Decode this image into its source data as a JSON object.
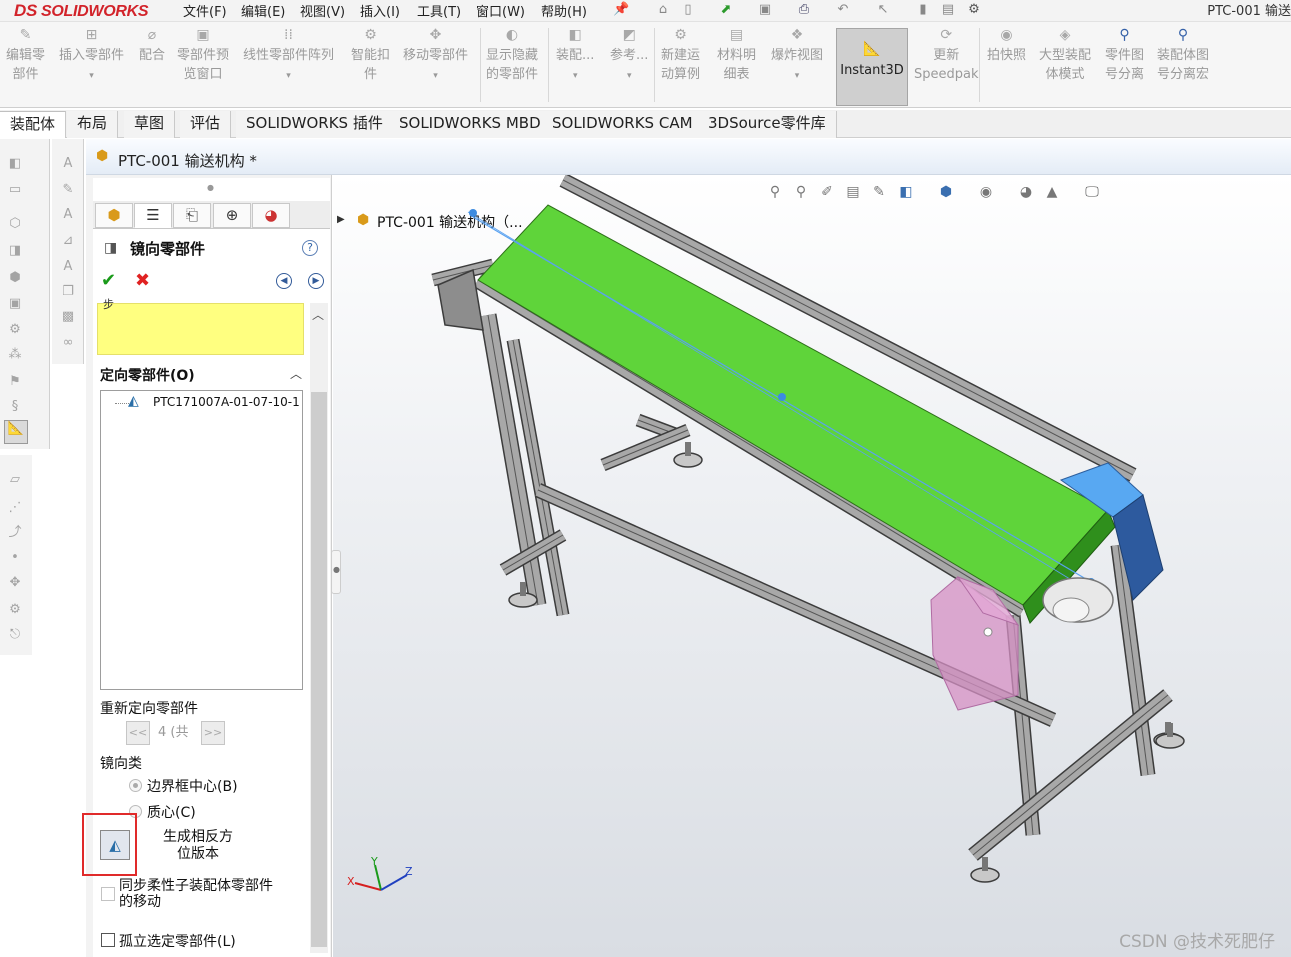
{
  "app": {
    "brand": "SOLIDWORKS",
    "brand_prefix": "DS",
    "document_title": "PTC-001 输送",
    "menu": [
      "文件(F)",
      "编辑(E)",
      "视图(V)",
      "插入(I)",
      "工具(T)",
      "窗口(W)",
      "帮助(H)"
    ]
  },
  "ribbon": {
    "buttons": [
      {
        "label1": "编辑零",
        "label2": "部件",
        "icon": "edit-component-icon"
      },
      {
        "label1": "插入零部件",
        "label2": "",
        "icon": "insert-component-icon"
      },
      {
        "label1": "配合",
        "label2": "",
        "icon": "mate-icon"
      },
      {
        "label1": "零部件预",
        "label2": "览窗口",
        "icon": "preview-window-icon"
      },
      {
        "label1": "线性零部件阵列",
        "label2": "",
        "icon": "linear-pattern-icon"
      },
      {
        "label1": "智能扣",
        "label2": "件",
        "icon": "smart-fastener-icon"
      },
      {
        "label1": "移动零部件",
        "label2": "",
        "icon": "move-component-icon"
      },
      {
        "label1": "显示隐藏",
        "label2": "的零部件",
        "icon": "show-hidden-icon"
      },
      {
        "label1": "装配...",
        "label2": "",
        "icon": "assembly-feature-icon"
      },
      {
        "label1": "参考...",
        "label2": "",
        "icon": "reference-geometry-icon"
      },
      {
        "label1": "新建运",
        "label2": "动算例",
        "icon": "motion-study-icon"
      },
      {
        "label1": "材料明",
        "label2": "细表",
        "icon": "bom-icon"
      },
      {
        "label1": "爆炸视图",
        "label2": "",
        "icon": "exploded-view-icon"
      },
      {
        "label1": "更新",
        "label2": "Speedpak",
        "icon": "speedpak-icon"
      },
      {
        "label1": "拍快照",
        "label2": "",
        "icon": "snapshot-icon"
      },
      {
        "label1": "大型装配",
        "label2": "体模式",
        "icon": "large-assembly-icon"
      },
      {
        "label1": "零件图",
        "label2": "号分离",
        "icon": "part-number-icon"
      },
      {
        "label1": "装配体图",
        "label2": "号分离宏",
        "icon": "assembly-number-icon"
      }
    ],
    "instant3d": "Instant3D"
  },
  "tabs": [
    "装配体",
    "布局",
    "草图",
    "评估",
    "SOLIDWORKS 插件",
    "SOLIDWORKS MBD",
    "SOLIDWORKS CAM",
    "3DSource零件库"
  ],
  "doc_tab": {
    "title": "PTC-001 输送机构 *"
  },
  "property_manager": {
    "title": "镜向零部件",
    "help": "?",
    "selection_hint": "步",
    "section_oriented": "定向零部件(O)",
    "list_items": [
      "PTC171007A-01-07-10-1"
    ],
    "reorient_label": "重新定向零部件",
    "prev_label": "<<",
    "next_label": ">>",
    "counter": "4 (共",
    "mirror_type_label": "镜向类",
    "radio_bbox": "边界框中心(B)",
    "radio_centroid": "质心(C)",
    "flip_label1": "生成相反方",
    "flip_label2": "位版本",
    "sync_label1": "同步柔性子装配体零部件",
    "sync_label2": "的移动",
    "isolate_label": "孤立选定零部件(L)"
  },
  "viewport": {
    "tree_label": "PTC-001 输送机构（...",
    "axis_x": "X",
    "axis_y": "Y",
    "axis_z": "Z",
    "colors": {
      "belt": "#5fd43a",
      "belt_side": "#2f8f1c",
      "motor_cover": "#58a8f2",
      "mirror_part": "#d690c4",
      "frame": "#3c3c3c"
    }
  },
  "watermark": "CSDN @技术死肥仔"
}
